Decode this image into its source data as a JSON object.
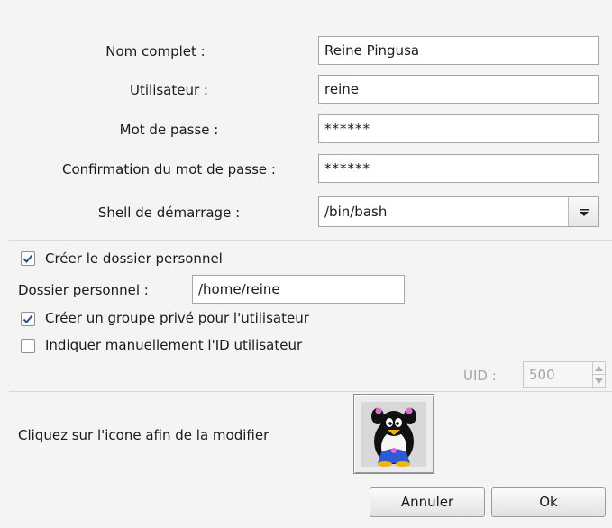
{
  "form": {
    "full_name": {
      "label": "Nom complet :",
      "value": "Reine Pingusa"
    },
    "user": {
      "label": "Utilisateur :",
      "value": "reine"
    },
    "password": {
      "label": "Mot de passe :",
      "value": "******"
    },
    "confirm": {
      "label": "Confirmation du mot de passe :",
      "value": "******"
    },
    "shell": {
      "label": "Shell de démarrage :",
      "value": "/bin/bash",
      "icon": "chevron-down-icon"
    }
  },
  "options": {
    "create_home": {
      "label": "Créer le dossier personnel",
      "checked": true
    },
    "home_dir": {
      "label": "Dossier personnel :",
      "value": "/home/reine"
    },
    "private_group": {
      "label": "Créer un groupe privé pour l'utilisateur",
      "checked": true
    },
    "manual_uid": {
      "label": "Indiquer manuellement l'ID utilisateur",
      "checked": false
    },
    "uid": {
      "label": "UID :",
      "value": "500"
    }
  },
  "icon_section": {
    "label": "Cliquez sur l'icone afin de la modifier",
    "icon": "penguin-avatar-icon"
  },
  "buttons": {
    "cancel": "Annuler",
    "ok": "Ok"
  },
  "colors": {
    "background": "#f4f4f4",
    "border": "#a6a6a6",
    "check": "#2a4f8f"
  }
}
